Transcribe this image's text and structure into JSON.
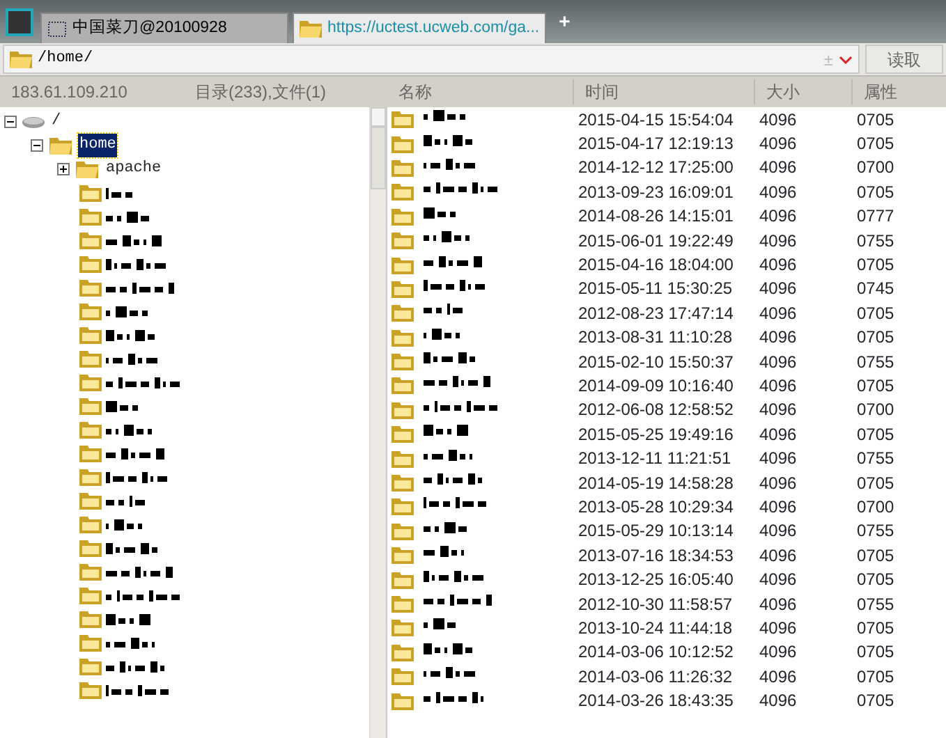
{
  "tabs": [
    {
      "label": "中国菜刀@20100928",
      "selected": false,
      "kind": "shell"
    },
    {
      "label": "https://uctest.ucweb.com/ga...",
      "selected": true,
      "kind": "folder"
    }
  ],
  "new_tab": "+",
  "address_bar": {
    "value": "/home/",
    "toggle": "±",
    "button": "读取"
  },
  "info": {
    "host": "183.61.109.210",
    "counts": "目录(233),文件(1)"
  },
  "columns": [
    "名称",
    "时间",
    "大小",
    "属性"
  ],
  "tree": [
    {
      "label": "/",
      "kind": "drive",
      "expanded": true,
      "selected": false,
      "children": [
        {
          "label": "home",
          "kind": "folder",
          "expanded": true,
          "selected": true,
          "children": [
            {
              "label": "apache",
              "kind": "folder",
              "expanded": false,
              "selected": false
            },
            {
              "kind": "redacted"
            },
            {
              "kind": "redacted"
            },
            {
              "kind": "redacted"
            },
            {
              "kind": "redacted"
            },
            {
              "kind": "redacted"
            },
            {
              "kind": "redacted"
            },
            {
              "kind": "redacted"
            },
            {
              "kind": "redacted"
            },
            {
              "kind": "redacted"
            },
            {
              "kind": "redacted"
            },
            {
              "kind": "redacted"
            },
            {
              "kind": "redacted"
            },
            {
              "kind": "redacted"
            },
            {
              "kind": "redacted"
            },
            {
              "kind": "redacted"
            },
            {
              "kind": "redacted"
            },
            {
              "kind": "redacted"
            },
            {
              "kind": "redacted"
            },
            {
              "kind": "redacted"
            },
            {
              "kind": "redacted"
            },
            {
              "kind": "redacted"
            },
            {
              "kind": "redacted"
            }
          ]
        }
      ]
    }
  ],
  "rows": [
    {
      "time": "2015-04-15 15:54:04",
      "size": "4096",
      "perm": "0705"
    },
    {
      "time": "2015-04-17 12:19:13",
      "size": "4096",
      "perm": "0705"
    },
    {
      "time": "2014-12-12 17:25:00",
      "size": "4096",
      "perm": "0700"
    },
    {
      "time": "2013-09-23 16:09:01",
      "size": "4096",
      "perm": "0705"
    },
    {
      "time": "2014-08-26 14:15:01",
      "size": "4096",
      "perm": "0777"
    },
    {
      "time": "2015-06-01 19:22:49",
      "size": "4096",
      "perm": "0755"
    },
    {
      "time": "2015-04-16 18:04:00",
      "size": "4096",
      "perm": "0705"
    },
    {
      "time": "2015-05-11 15:30:25",
      "size": "4096",
      "perm": "0745"
    },
    {
      "time": "2012-08-23 17:47:14",
      "size": "4096",
      "perm": "0705"
    },
    {
      "time": "2013-08-31 11:10:28",
      "size": "4096",
      "perm": "0705"
    },
    {
      "time": "2015-02-10 15:50:37",
      "size": "4096",
      "perm": "0755"
    },
    {
      "time": "2014-09-09 10:16:40",
      "size": "4096",
      "perm": "0705"
    },
    {
      "time": "2012-06-08 12:58:52",
      "size": "4096",
      "perm": "0700"
    },
    {
      "time": "2015-05-25 19:49:16",
      "size": "4096",
      "perm": "0705"
    },
    {
      "time": "2013-12-11 11:21:51",
      "size": "4096",
      "perm": "0755"
    },
    {
      "time": "2014-05-19 14:58:28",
      "size": "4096",
      "perm": "0705"
    },
    {
      "time": "2013-05-28 10:29:34",
      "size": "4096",
      "perm": "0700"
    },
    {
      "time": "2015-05-29 10:13:14",
      "size": "4096",
      "perm": "0755"
    },
    {
      "time": "2013-07-16 18:34:53",
      "size": "4096",
      "perm": "0705"
    },
    {
      "time": "2013-12-25 16:05:40",
      "size": "4096",
      "perm": "0705"
    },
    {
      "time": "2012-10-30 11:58:57",
      "size": "4096",
      "perm": "0755"
    },
    {
      "time": "2013-10-24 11:44:18",
      "size": "4096",
      "perm": "0705"
    },
    {
      "time": "2014-03-06 10:12:52",
      "size": "4096",
      "perm": "0705"
    },
    {
      "time": "2014-03-06 11:26:32",
      "size": "4096",
      "perm": "0705"
    },
    {
      "time": "2014-03-26 18:43:35",
      "size": "4096",
      "perm": "0705"
    }
  ]
}
